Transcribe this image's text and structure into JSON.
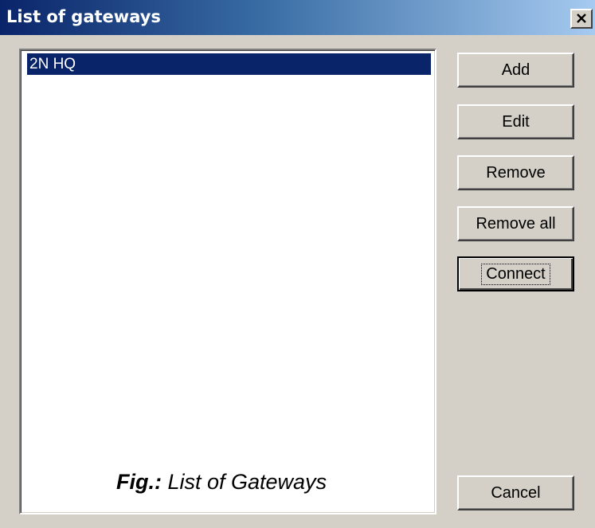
{
  "window": {
    "title": "List of gateways",
    "close_icon": "close-icon"
  },
  "gateways": {
    "items": [
      {
        "label": "2N HQ",
        "selected": true
      }
    ]
  },
  "buttons": {
    "add": "Add",
    "edit": "Edit",
    "remove": "Remove",
    "remove_all": "Remove all",
    "connect": "Connect",
    "cancel": "Cancel"
  },
  "caption": {
    "prefix": "Fig.:",
    "text": " List of Gateways"
  },
  "colors": {
    "titlebar_start": "#0a246a",
    "titlebar_end": "#a6caf0",
    "dialog_bg": "#d4d0c8",
    "selection_bg": "#0a246a",
    "selection_text": "#ffffff"
  }
}
